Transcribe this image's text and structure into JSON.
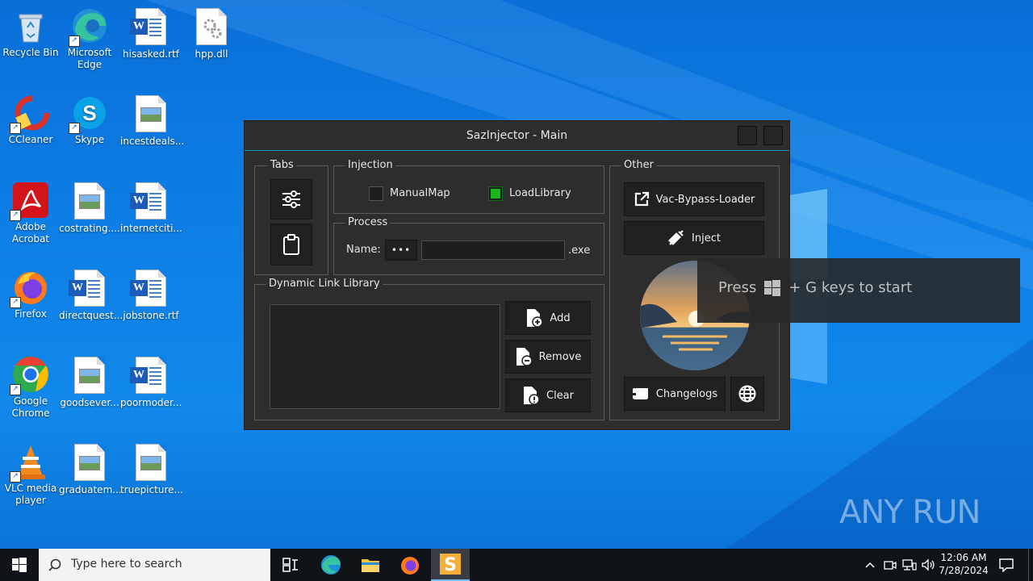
{
  "desktop": {
    "icons": [
      {
        "label": "Recycle Bin",
        "icon": "recycle-bin-icon"
      },
      {
        "label": "Microsoft Edge",
        "icon": "edge-icon"
      },
      {
        "label": "hisasked.rtf",
        "icon": "word-doc-icon"
      },
      {
        "label": "hpp.dll",
        "icon": "dll-file-icon"
      },
      {
        "label": "CCleaner",
        "icon": "ccleaner-icon"
      },
      {
        "label": "Skype",
        "icon": "skype-icon"
      },
      {
        "label": "incestdeals...",
        "icon": "image-file-icon"
      },
      {
        "label": "Adobe Acrobat",
        "icon": "acrobat-icon"
      },
      {
        "label": "costrating....",
        "icon": "image-file-icon"
      },
      {
        "label": "internetciti...",
        "icon": "word-doc-icon"
      },
      {
        "label": "Firefox",
        "icon": "firefox-icon"
      },
      {
        "label": "directquest...",
        "icon": "word-doc-icon"
      },
      {
        "label": "jobstone.rtf",
        "icon": "word-doc-icon"
      },
      {
        "label": "Google Chrome",
        "icon": "chrome-icon"
      },
      {
        "label": "goodsever...",
        "icon": "image-file-icon"
      },
      {
        "label": "poormoder...",
        "icon": "word-doc-icon"
      },
      {
        "label": "VLC media player",
        "icon": "vlc-icon"
      },
      {
        "label": "graduatem...",
        "icon": "image-file-icon"
      },
      {
        "label": "truepicture...",
        "icon": "image-file-icon"
      }
    ]
  },
  "window": {
    "title": "SazInjector - Main",
    "tabs_group": "Tabs",
    "injection_group": "Injection",
    "manualmap_label": "ManualMap",
    "manualmap_checked": false,
    "loadlibrary_label": "LoadLibrary",
    "loadlibrary_checked": true,
    "process_group": "Process",
    "name_label": "Name:",
    "browse_label": "•••",
    "process_value": "",
    "exe_suffix": ".exe",
    "dll_group": "Dynamic Link Library",
    "add_label": "Add",
    "remove_label": "Remove",
    "clear_label": "Clear",
    "other_group": "Other",
    "vac_label": "Vac-Bypass-Loader",
    "inject_label": "Inject",
    "changelogs_label": "Changelogs",
    "accent_color": "#1593c2",
    "checked_color": "#19b818"
  },
  "gamebar_toast": {
    "text_before": "Press",
    "text_after": "+ G keys to start"
  },
  "watermark": "ANY RUN",
  "taskbar": {
    "search_placeholder": "Type here to search",
    "time": "12:06 AM",
    "date": "7/28/2024"
  }
}
